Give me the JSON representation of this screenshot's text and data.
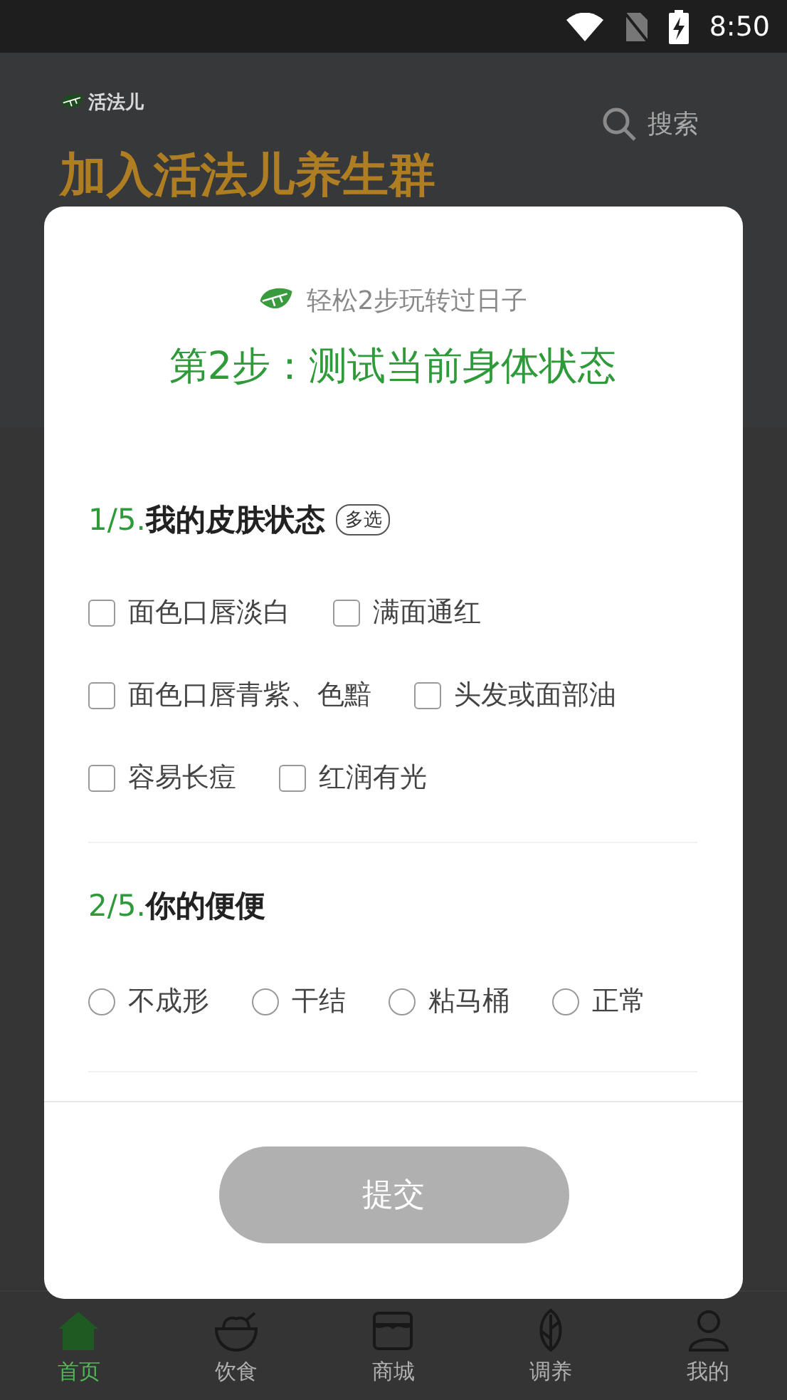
{
  "status_bar": {
    "time": "8:50"
  },
  "header": {
    "logo": "活法儿",
    "search": {
      "placeholder": "搜索"
    }
  },
  "banner": {
    "headline": "加入活法儿养生群"
  },
  "dialog": {
    "subtitle": "轻松2步玩转过日子",
    "title": "第2步：测试当前身体状态",
    "questions": [
      {
        "kind": "multi",
        "number": "1/5.",
        "title": "我的皮肤状态",
        "badge": "多选",
        "options": [
          {
            "label": "面色口唇淡白",
            "checked": false
          },
          {
            "label": "满面通红",
            "checked": false
          },
          {
            "label": "面色口唇青紫、色黯",
            "checked": false
          },
          {
            "label": "头发或面部油",
            "checked": false
          },
          {
            "label": "容易长痘",
            "checked": false
          },
          {
            "label": "红润有光",
            "checked": false
          }
        ]
      },
      {
        "kind": "single",
        "number": "2/5.",
        "title": "你的便便",
        "options": [
          {
            "label": "不成形",
            "selected": false
          },
          {
            "label": "干结",
            "selected": false
          },
          {
            "label": "粘马桶",
            "selected": false
          },
          {
            "label": "正常",
            "selected": false
          }
        ]
      }
    ],
    "submit_button": {
      "label": "提交",
      "disabled": true
    }
  },
  "bottom_nav": [
    {
      "kind": "home",
      "label": "首页",
      "selected": true
    },
    {
      "kind": "food",
      "label": "饮食",
      "selected": false
    },
    {
      "kind": "shop",
      "label": "商城",
      "selected": false
    },
    {
      "kind": "care",
      "label": "调养",
      "selected": false
    },
    {
      "kind": "me",
      "label": "我的",
      "selected": false
    }
  ]
}
